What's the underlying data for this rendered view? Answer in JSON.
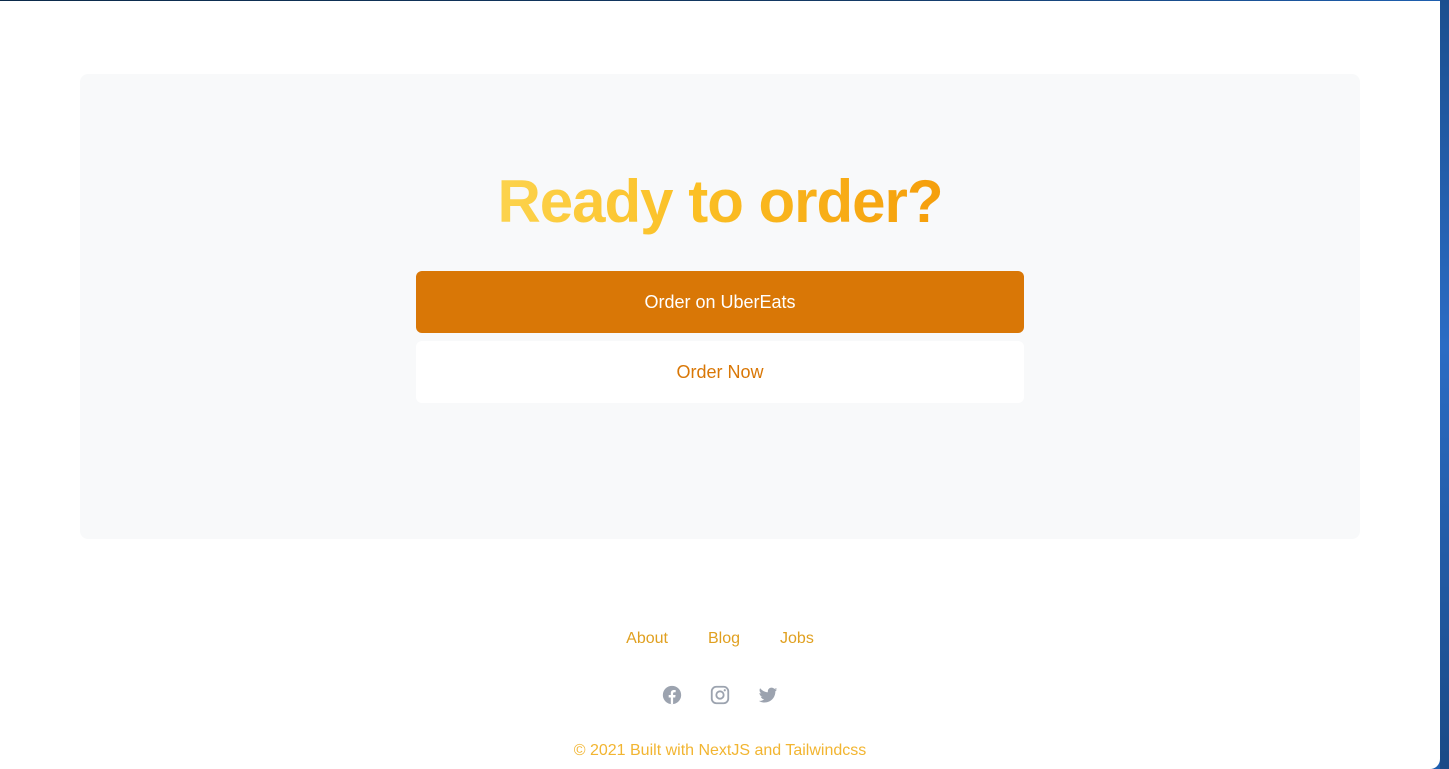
{
  "cta": {
    "heading": "Ready to order?",
    "primary_button": "Order on UberEats",
    "secondary_button": "Order Now"
  },
  "footer": {
    "links": [
      {
        "label": "About"
      },
      {
        "label": "Blog"
      },
      {
        "label": "Jobs"
      }
    ],
    "social_icons": [
      "facebook-icon",
      "instagram-icon",
      "twitter-icon"
    ],
    "copyright": "© 2021 Built with NextJS and Tailwindcss"
  },
  "colors": {
    "accent": "#d97706",
    "heading_gradient_start": "#fcd34d",
    "heading_gradient_end": "#f59e0b",
    "panel_background": "#f8f9fa",
    "icon_gray": "#9ca3af"
  }
}
